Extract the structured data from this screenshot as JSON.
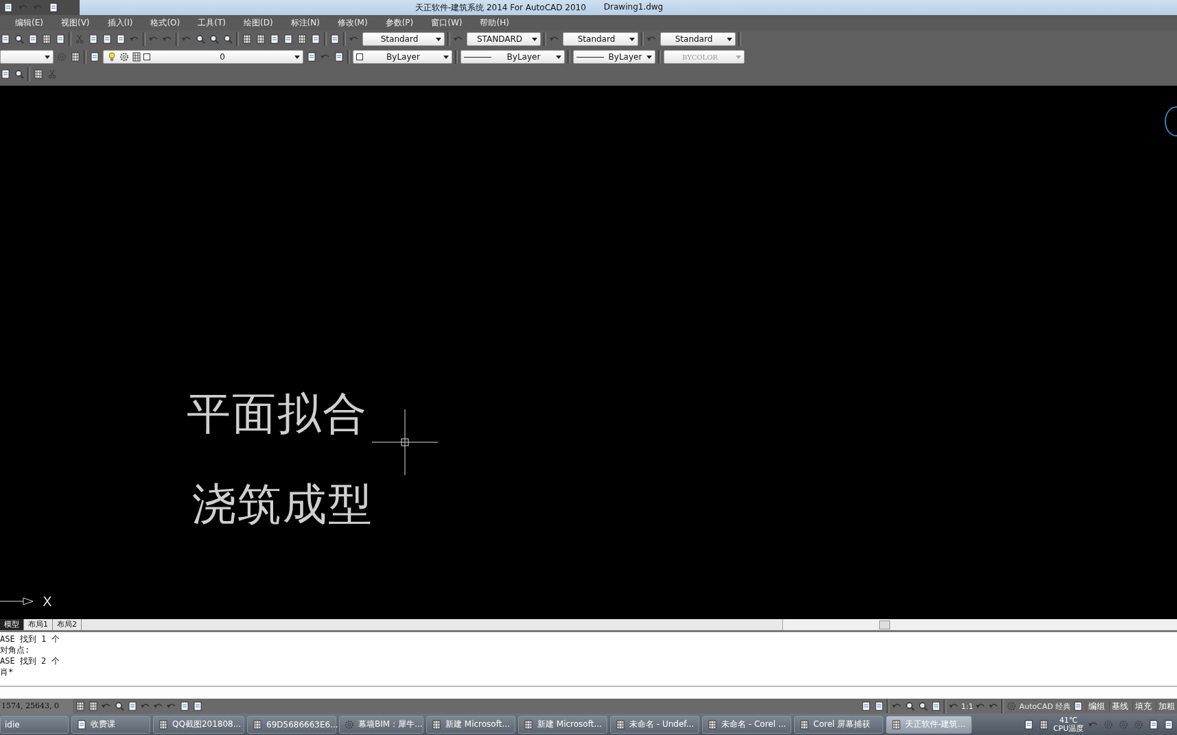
{
  "window": {
    "title": "天正软件-建筑系统 2014  For AutoCAD 2010",
    "document": "Drawing1.dwg"
  },
  "menu": [
    "编辑(E)",
    "视图(V)",
    "插入(I)",
    "格式(O)",
    "工具(T)",
    "绘图(D)",
    "标注(N)",
    "修改(M)",
    "参数(P)",
    "窗口(W)",
    "帮助(H)"
  ],
  "styles_toolbar": [
    "Standard",
    "STANDARD",
    "Standard",
    "Standard"
  ],
  "layers_toolbar": {
    "layer": "0",
    "color_setting": "ByLayer",
    "linetype": "ByLayer",
    "lineweight": "ByLayer",
    "plot_style": {
      "value": "BYCOLOR",
      "disabled": true
    }
  },
  "drawing": {
    "texts": [
      "平面拟合",
      "浇筑成型"
    ],
    "axis_label": "X"
  },
  "layout_tabs": [
    {
      "label": "模型",
      "selected": true
    },
    {
      "label": "布局1",
      "selected": false
    },
    {
      "label": "布局2",
      "selected": false
    }
  ],
  "command_lines": [
    "ASE 找到 1 个",
    "对角点:",
    "ASE 找到 2 个",
    "肖*"
  ],
  "status_bar": {
    "coordinates": "1574, 25643, 0",
    "scale": "1:1",
    "workspace": "AutoCAD 经典",
    "buttons": [
      "编组",
      "基线",
      "填充",
      "加粗"
    ]
  },
  "taskbar": {
    "items": [
      {
        "label": "idie",
        "active": false
      },
      {
        "label": "收费课",
        "active": false
      },
      {
        "label": "QQ截图201808...",
        "active": false
      },
      {
        "label": "69D5686663E6...",
        "active": false
      },
      {
        "label": "幕墙BIM：犀牛...",
        "active": false
      },
      {
        "label": "新建 Microsoft...",
        "active": false
      },
      {
        "label": "新建 Microsoft...",
        "active": false
      },
      {
        "label": "未命名 - Undef...",
        "active": false
      },
      {
        "label": "未命名 - Corel ...",
        "active": false
      },
      {
        "label": "Corel 屏幕捕获",
        "active": false
      },
      {
        "label": "天正软件-建筑...",
        "active": true
      }
    ],
    "temperature": "41℃",
    "temperature_label": "CPU温度"
  }
}
